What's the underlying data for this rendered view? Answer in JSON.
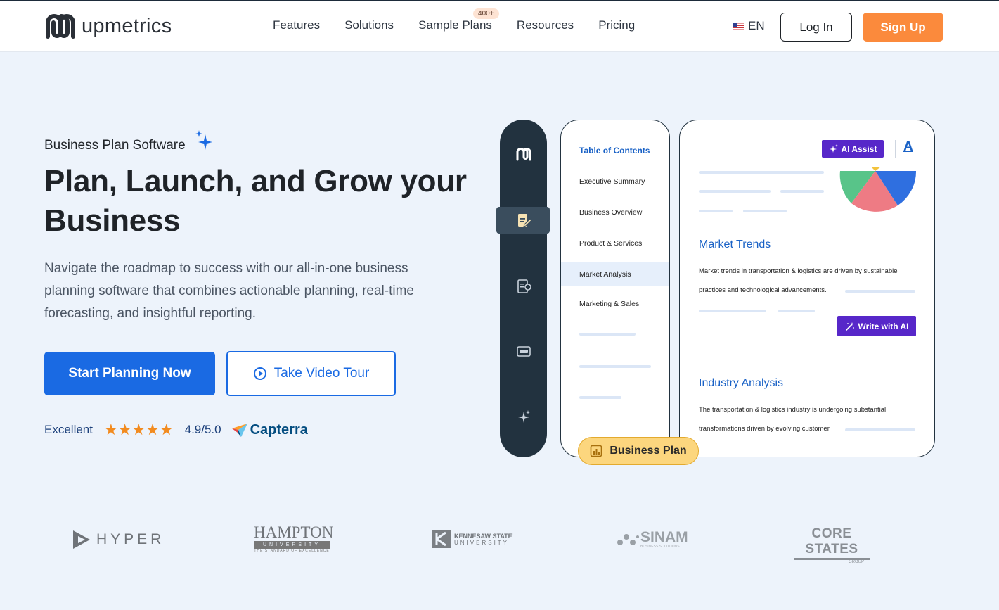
{
  "brand": {
    "name": "upmetrics"
  },
  "nav": {
    "items": [
      "Features",
      "Solutions",
      "Sample Plans",
      "Resources",
      "Pricing"
    ],
    "sample_plans_badge": "400+"
  },
  "header": {
    "language": "EN",
    "login_label": "Log In",
    "signup_label": "Sign Up"
  },
  "hero": {
    "eyebrow": "Business Plan Software",
    "title": "Plan, Launch, and Grow your Business",
    "description": "Navigate the roadmap to success with our all-in-one business planning software that combines actionable planning, real-time forecasting, and insightful reporting.",
    "primary_cta": "Start Planning Now",
    "secondary_cta": "Take Video Tour"
  },
  "rating": {
    "label": "Excellent",
    "stars": "★★★★★",
    "score": "4.9/5.0",
    "source": "Capterra"
  },
  "illustration": {
    "toc_title": "Table of Contents",
    "toc_items": [
      "Executive Summary",
      "Business Overview",
      "Product & Services",
      "Market Analysis",
      "Marketing & Sales"
    ],
    "ai_assist_label": "AI Assist",
    "font_icon_glyph": "A",
    "market_trends": {
      "title": "Market Trends",
      "text": "Market trends in transportation & logistics are driven by sustainable practices and technological advancements."
    },
    "write_with_ai_label": "Write with AI",
    "industry_analysis": {
      "title": "Industry  Analysis",
      "text": "The transportation & logistics industry is undergoing substantial transformations driven by evolving customer"
    },
    "business_plan_chip": "Business Plan"
  },
  "partners": {
    "hyper": "HYPER",
    "hampton_title": "HAMPTON",
    "hampton_band": "UNIVERSITY",
    "hampton_tag": "THE STANDARD OF EXCELLENCE",
    "kennesaw_line1": "KENNESAW STATE",
    "kennesaw_line2": "UNIVERSITY",
    "sinam": "SINAM",
    "sinam_tag": "BUSINESS SOLUTIONS",
    "core_states": "CORE STATES",
    "core_states_tag": "GROUP"
  },
  "colors": {
    "primary": "#1a6ae3",
    "accent_orange": "#fb8a3c",
    "dark": "#22323f",
    "ai_purple": "#5727c9",
    "star": "#f28b1f"
  }
}
